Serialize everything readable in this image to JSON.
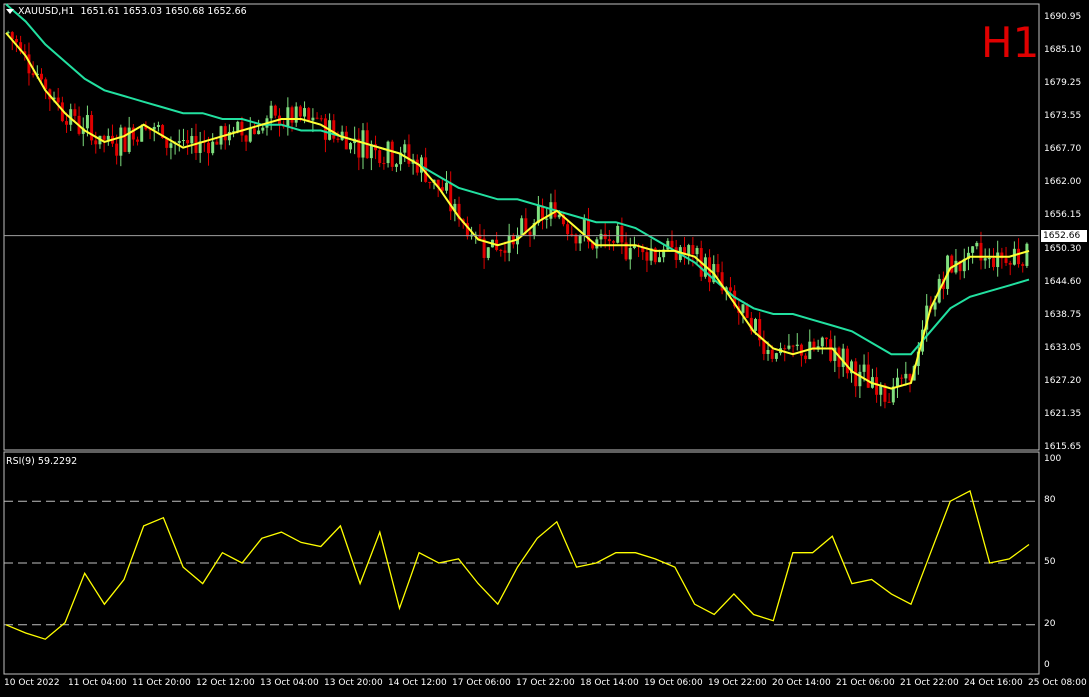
{
  "header": {
    "symbol_tf": "XAUUSD,H1",
    "ohlc": "1651.61 1653.03 1650.68 1652.66"
  },
  "timeframe_label": "H1",
  "current_price": "1652.66",
  "price_axis": [
    "1690.95",
    "1685.10",
    "1679.25",
    "1673.55",
    "1667.70",
    "1662.00",
    "1656.15",
    "1650.30",
    "1644.60",
    "1638.75",
    "1633.05",
    "1627.20",
    "1621.35",
    "1615.65"
  ],
  "rsi": {
    "label": "RSI(9) 59.2292",
    "axis": [
      "100",
      "80",
      "50",
      "20",
      "0"
    ],
    "levels": [
      80,
      50,
      20
    ]
  },
  "time_axis": [
    "10 Oct 2022",
    "11 Oct 04:00",
    "11 Oct 20:00",
    "12 Oct 12:00",
    "13 Oct 04:00",
    "13 Oct 20:00",
    "14 Oct 12:00",
    "17 Oct 06:00",
    "17 Oct 22:00",
    "18 Oct 14:00",
    "19 Oct 06:00",
    "19 Oct 22:00",
    "20 Oct 14:00",
    "21 Oct 06:00",
    "21 Oct 22:00",
    "24 Oct 16:00",
    "25 Oct 08:00"
  ],
  "colors": {
    "background": "#000000",
    "bull": "#7fdf7f",
    "bear": "#e00000",
    "ma_fast": "#ffff33",
    "ma_slow": "#22e0a0",
    "rsi_line": "#ffff00",
    "grid": "#c0c0c0"
  },
  "chart_data": {
    "type": "candlestick",
    "price_range": [
      1615.65,
      1690.95
    ],
    "ma_fast": [
      1688,
      1684,
      1678,
      1674,
      1671,
      1669,
      1670,
      1672,
      1670,
      1668,
      1669,
      1670,
      1671,
      1672,
      1673,
      1673,
      1672,
      1670,
      1669,
      1668,
      1667,
      1665,
      1661,
      1656,
      1652,
      1651,
      1652,
      1655,
      1657,
      1654,
      1651,
      1651,
      1651,
      1650,
      1650,
      1649,
      1646,
      1641,
      1636,
      1633,
      1632,
      1633,
      1633,
      1629,
      1627,
      1626,
      1627,
      1640,
      1647,
      1649,
      1649,
      1649,
      1650
    ],
    "ma_slow": [
      1693,
      1690,
      1686,
      1683,
      1680,
      1678,
      1677,
      1676,
      1675,
      1674,
      1674,
      1673,
      1673,
      1672,
      1672,
      1671,
      1671,
      1670,
      1669,
      1668,
      1667,
      1665,
      1663,
      1661,
      1660,
      1659,
      1659,
      1658,
      1657,
      1656,
      1655,
      1655,
      1654,
      1652,
      1650,
      1648,
      1645,
      1642,
      1640,
      1639,
      1639,
      1638,
      1637,
      1636,
      1634,
      1632,
      1632,
      1636,
      1640,
      1642,
      1643,
      1644,
      1645
    ],
    "rsi": [
      20,
      16,
      13,
      21,
      45,
      30,
      42,
      68,
      72,
      48,
      40,
      55,
      50,
      62,
      65,
      60,
      58,
      68,
      40,
      65,
      28,
      55,
      50,
      52,
      40,
      30,
      48,
      62,
      70,
      48,
      50,
      55,
      55,
      52,
      48,
      30,
      25,
      35,
      25,
      22,
      55,
      55,
      63,
      40,
      42,
      35,
      30,
      55,
      80,
      85,
      50,
      52,
      59
    ]
  }
}
